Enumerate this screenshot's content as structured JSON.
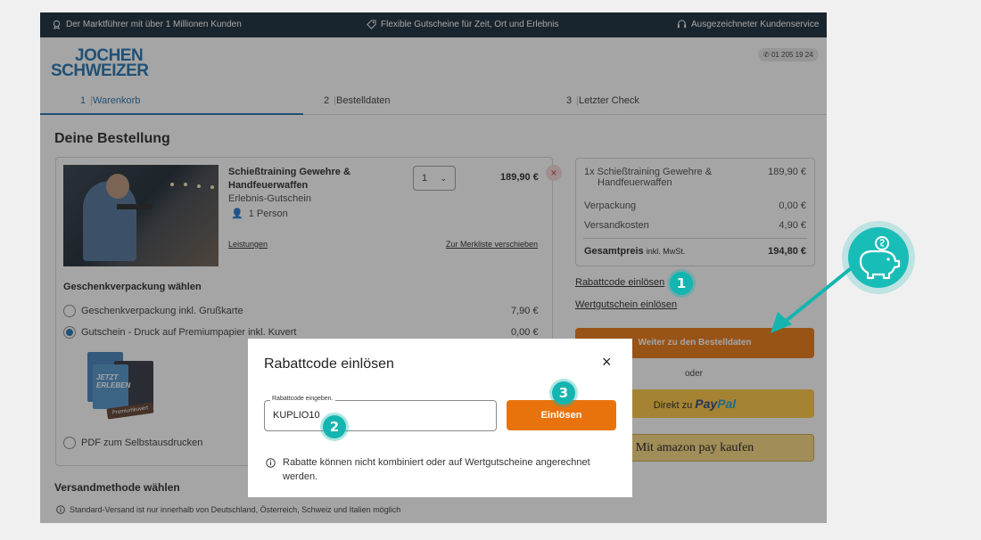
{
  "topbar": {
    "items": [
      "Der Marktführer mit über 1 Millionen Kunden",
      "Flexible Gutscheine für Zeit, Ort und Erlebnis",
      "Ausgezeichneter Kundenservice"
    ],
    "icons": [
      "badge-icon",
      "tag-icon",
      "headset-icon"
    ]
  },
  "header": {
    "logo_line1": "JOCHEN",
    "logo_line2": "SCHWEIZER",
    "phone": "01 205 19 24"
  },
  "steps": [
    {
      "num": "1",
      "label": "Warenkorb",
      "active": true
    },
    {
      "num": "2",
      "label": "Bestelldaten",
      "active": false
    },
    {
      "num": "3",
      "label": "Letzter Check",
      "active": false
    }
  ],
  "order": {
    "title": "Deine Bestellung",
    "product": {
      "name": "Schießtraining Gewehre & Handfeuerwaffen",
      "type": "Erlebnis-Gutschein",
      "persons": "1 Person",
      "quantity": "1",
      "price": "189,90 €",
      "remove": "×",
      "link_services": "Leistungen",
      "link_wishlist": "Zur Merkliste verschieben"
    },
    "gift": {
      "title": "Geschenkverpackung wählen",
      "options": [
        {
          "label": "Geschenkverpackung inkl. Grußkarte",
          "price": "7,90 €",
          "selected": false
        },
        {
          "label": "Gutschein - Druck auf Premiumpapier inkl. Kuvert",
          "price": "0,00 €",
          "selected": true
        },
        {
          "label": "PDF zum Selbstausdrucken",
          "price": "",
          "selected": false
        }
      ],
      "voucher_text1": "JETZT",
      "voucher_text2": "ERLEBEN",
      "voucher_tag": "Premiumkuvert"
    }
  },
  "summary": {
    "item_label": "1x Schießtraining Gewehre &",
    "item_label2": "Handfeuerwaffen",
    "item_price": "189,90 €",
    "packaging_label": "Verpackung",
    "packaging_price": "0,00 €",
    "shipping_label": "Versandkosten",
    "shipping_price": "4,90 €",
    "total_label": "Gesamtpreis",
    "total_suffix": "inkl. MwSt.",
    "total_price": "194,80 €"
  },
  "actions": {
    "coupon_link": "Rabattcode einlösen",
    "voucher_link": "Wertgutschein einlösen",
    "next_button": "Weiter zu den Bestelldaten",
    "or": "oder",
    "paypal_prefix": "Direkt zu",
    "paypal_brand1": "Pay",
    "paypal_brand2": "Pal",
    "amazon_label": "Mit amazon pay kaufen"
  },
  "shipping": {
    "title": "Versandmethode wählen",
    "note": "Standard-Versand ist nur innerhalb von Deutschland, Österreich, Schweiz und Italien möglich"
  },
  "modal": {
    "title": "Rabattcode einlösen",
    "close": "×",
    "field_label": "Rabattcode eingeben.",
    "field_value": "KUPLIO10",
    "redeem_button": "Einlösen",
    "info": "Rabatte können nicht kombiniert oder auf Wertgutscheine angerechnet werden."
  },
  "annotations": {
    "badges": [
      "1",
      "2",
      "3"
    ],
    "accent_color": "#14b5b0",
    "icon": "piggy-bank-icon"
  },
  "colors": {
    "topbar": "#0f2433",
    "brand_blue": "#1a6eb0",
    "orange": "#e8720c",
    "paypal_yellow": "#ffc439"
  }
}
